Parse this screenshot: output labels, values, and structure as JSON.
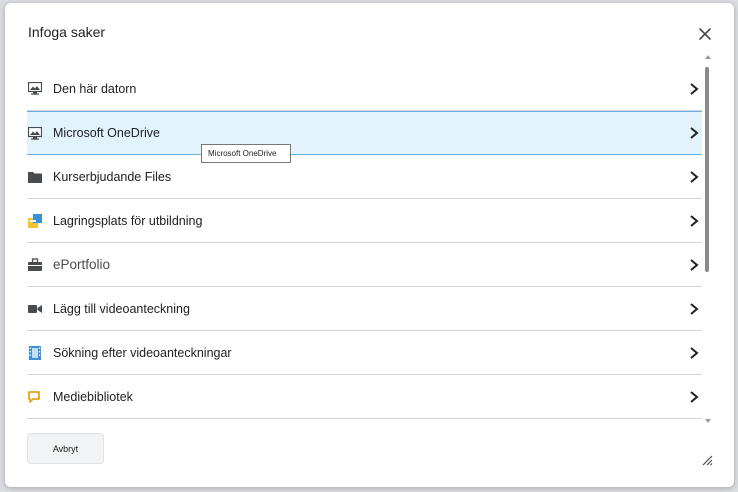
{
  "dialog": {
    "title": "Infoga saker",
    "close_icon": "close-icon",
    "items": [
      {
        "label": "Den här datorn",
        "icon": "monitor-icon"
      },
      {
        "label": "Microsoft OneDrive",
        "icon": "monitor-icon",
        "selected": true
      },
      {
        "label": "Kurserbjudande Files",
        "icon": "folder-icon"
      },
      {
        "label": "Lagringsplats för utbildning",
        "icon": "storage-icon"
      },
      {
        "label": "ePortfolio",
        "icon": "briefcase-icon"
      },
      {
        "label": "Lägg till videoanteckning",
        "icon": "video-camera-icon"
      },
      {
        "label": "Sökning efter videoanteckningar",
        "icon": "film-icon"
      },
      {
        "label": "Mediebibliotek",
        "icon": "media-icon"
      }
    ],
    "tooltip": "Microsoft OneDrive",
    "cancel_label": "Avbryt"
  },
  "colors": {
    "selected_bg": "#e3f3fc",
    "selected_border": "#6ab1e2",
    "divider": "#d3d6d9"
  }
}
